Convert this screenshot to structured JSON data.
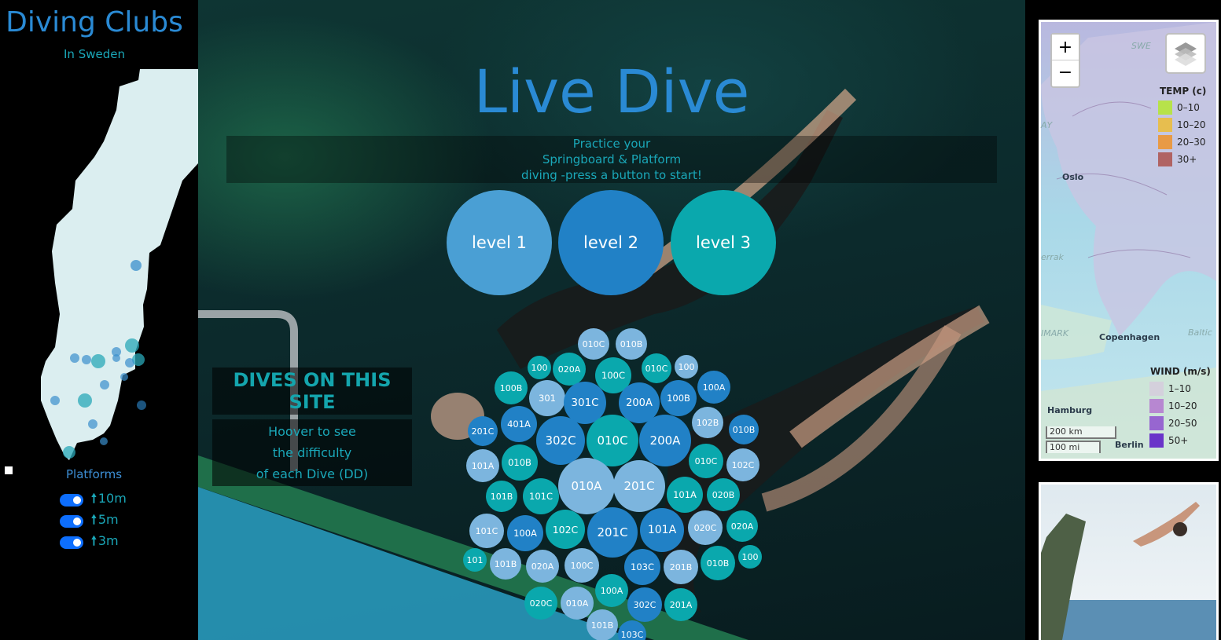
{
  "sidebar": {
    "title": "Diving Clubs",
    "subtitle": "In Sweden",
    "platforms_title": "Platforms",
    "platforms": [
      {
        "label": "10m",
        "enabled": true
      },
      {
        "label": "5m",
        "enabled": true
      },
      {
        "label": "3m",
        "enabled": true
      }
    ],
    "arrow_icon": "arrow-up-icon",
    "toggle_color": "#0d6efd"
  },
  "hero": {
    "title": "Live Dive",
    "subtitle_lines": [
      "Practice your",
      "Springboard & Platform",
      "diving -press a button to start!"
    ],
    "levels": [
      {
        "label": "level 1",
        "color": "#4a9fd4"
      },
      {
        "label": "level 2",
        "color": "#2181c6"
      },
      {
        "label": "level 3",
        "color": "#0aa8ad"
      }
    ],
    "dives_heading": "DIVES ON THIS SITE",
    "dives_text": [
      "Hoover to see",
      "the difficulty",
      "of each Dive (DD)"
    ],
    "dives": [
      "010C",
      "010B",
      "100",
      "020A",
      "100C",
      "010C",
      "100",
      "100B",
      "301",
      "301C",
      "200A",
      "100B",
      "100A",
      "401A",
      "201C",
      "302C",
      "010C",
      "200A",
      "102B",
      "010B",
      "101A",
      "010B",
      "010C",
      "102C",
      "010A",
      "201C",
      "101B",
      "101C",
      "101A",
      "020B",
      "101C",
      "100A",
      "102C",
      "201C",
      "101A",
      "020C",
      "020A",
      "101",
      "101B",
      "020A",
      "100C",
      "103C",
      "201B",
      "010B",
      "100",
      "100A",
      "020C",
      "010A",
      "302C",
      "201A",
      "101B",
      "103C"
    ],
    "bubble_colors": [
      "#7cb5de",
      "#2181c6",
      "#0aa8ad"
    ]
  },
  "map": {
    "zoom_in": "+",
    "zoom_out": "−",
    "layers_icon": "layers-icon",
    "temp_title": "TEMP (c)",
    "temp_legend": [
      {
        "label": "0–10",
        "color": "#b7e24a"
      },
      {
        "label": "10–20",
        "color": "#e7be4f"
      },
      {
        "label": "20–30",
        "color": "#e89a45"
      },
      {
        "label": "30+",
        "color": "#b06363"
      }
    ],
    "wind_title": "WIND (m/s)",
    "wind_legend": [
      {
        "label": "1–10",
        "color": "#d4d0dc"
      },
      {
        "label": "10–20",
        "color": "#b787d1"
      },
      {
        "label": "20–50",
        "color": "#9766d0"
      },
      {
        "label": "50+",
        "color": "#6a34c9"
      }
    ],
    "scale_km": "200 km",
    "scale_mi": "100 mi",
    "places": [
      "Oslo",
      "Copenhagen",
      "Hamburg",
      "Berlin"
    ],
    "faint_labels": [
      "SWE",
      "AY",
      "errak",
      "IMARK",
      "Baltic"
    ]
  }
}
